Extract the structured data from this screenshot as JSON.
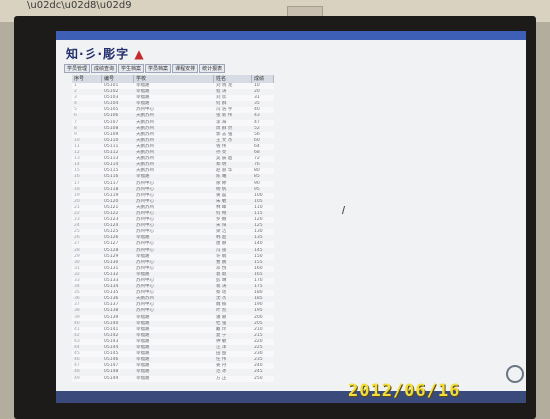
{
  "photo": {
    "timestamp": "2012/06/16"
  },
  "app": {
    "logo_left": "知·彡·彫字",
    "logo_mid": "  ",
    "tabs": [
      "学员管理",
      "成绩查询",
      "学生档案",
      "学员档案",
      "课程安排",
      "统计报表"
    ],
    "columns": [
      "序号",
      "编号",
      "学校",
      "姓名",
      "成绩"
    ],
    "rows": [
      [
        "1",
        "05101",
        "幸福路",
        "刘 晓 龙",
        "10"
      ],
      [
        "2",
        "05102",
        "幸福路",
        "程 涛",
        "20"
      ],
      [
        "3",
        "05103",
        "幸福路",
        "刘 欢",
        "31"
      ],
      [
        "4",
        "05104",
        "幸福路",
        "何 群",
        "35"
      ],
      [
        "5",
        "05105",
        "苏州中心",
        "冯 浩 宇",
        "40"
      ],
      [
        "6",
        "05106",
        "天鹏苏州",
        "张 新 伟",
        "43"
      ],
      [
        "7",
        "05107",
        "天鹏苏州",
        "李 海",
        "47"
      ],
      [
        "8",
        "05108",
        "天鹏苏州",
        "周 群 然",
        "52"
      ],
      [
        "9",
        "05109",
        "天鹏苏州",
        "郭 志 强",
        "56"
      ],
      [
        "10",
        "05110",
        "天鹏苏州",
        "王 文 杰",
        "60"
      ],
      [
        "11",
        "05111",
        "天鹏苏州",
        "钱 伟",
        "64"
      ],
      [
        "12",
        "05112",
        "天鹏苏州",
        "孙 亮",
        "68"
      ],
      [
        "13",
        "05113",
        "天鹏苏州",
        "吴 辰 超",
        "72"
      ],
      [
        "14",
        "05114",
        "天鹏苏州",
        "郑 明",
        "76"
      ],
      [
        "15",
        "05115",
        "天鹏苏州",
        "赵 丽 华",
        "80"
      ],
      [
        "16",
        "05116",
        "幸福路",
        "陈 曦",
        "85"
      ],
      [
        "17",
        "05117",
        "苏州中心",
        "徐 婷",
        "90"
      ],
      [
        "18",
        "05118",
        "苏州中心",
        "杨 帆",
        "95"
      ],
      [
        "19",
        "05119",
        "苏州中心",
        "黄 磊",
        "100"
      ],
      [
        "20",
        "05120",
        "苏州中心",
        "朱 敏",
        "105"
      ],
      [
        "21",
        "05121",
        "天鹏苏州",
        "林 峰",
        "110"
      ],
      [
        "22",
        "05122",
        "苏州中心",
        "何 畅",
        "115"
      ],
      [
        "23",
        "05123",
        "苏州中心",
        "罗 娜",
        "120"
      ],
      [
        "24",
        "05124",
        "苏州中心",
        "宋 阳",
        "125"
      ],
      [
        "25",
        "05125",
        "苏州中心",
        "梁 洁",
        "130"
      ],
      [
        "26",
        "05126",
        "幸福路",
        "韩 超",
        "135"
      ],
      [
        "27",
        "05127",
        "苏州中心",
        "唐 静",
        "140"
      ],
      [
        "28",
        "05128",
        "苏州中心",
        "冯 雷",
        "145"
      ],
      [
        "29",
        "05129",
        "幸福路",
        "许 娟",
        "150"
      ],
      [
        "30",
        "05130",
        "苏州中心",
        "曹 鹏",
        "155"
      ],
      [
        "31",
        "05131",
        "苏州中心",
        "邓 悦",
        "160"
      ],
      [
        "32",
        "05132",
        "幸福路",
        "袁 斌",
        "165"
      ],
      [
        "33",
        "05133",
        "苏州中心",
        "彭 琳",
        "170"
      ],
      [
        "34",
        "05134",
        "苏州中心",
        "蒋 涛",
        "175"
      ],
      [
        "35",
        "05135",
        "苏州中心",
        "蔡 瑶",
        "180"
      ],
      [
        "36",
        "05136",
        "天鹏苏州",
        "沈 杰",
        "185"
      ],
      [
        "37",
        "05137",
        "苏州中心",
        "魏 楠",
        "190"
      ],
      [
        "38",
        "05138",
        "苏州中心",
        "叶 凯",
        "195"
      ],
      [
        "39",
        "05139",
        "幸福路",
        "潘 颖",
        "200"
      ],
      [
        "40",
        "05140",
        "幸福路",
        "杜 强",
        "205"
      ],
      [
        "41",
        "05141",
        "幸福路",
        "戴 玲",
        "210"
      ],
      [
        "42",
        "05142",
        "幸福路",
        "夏 宁",
        "215"
      ],
      [
        "43",
        "05143",
        "幸福路",
        "钟 敏",
        "220"
      ],
      [
        "44",
        "05144",
        "幸福路",
        "汪 洋",
        "225"
      ],
      [
        "45",
        "05145",
        "幸福路",
        "田 甜",
        "230"
      ],
      [
        "46",
        "05146",
        "幸福路",
        "任 伟",
        "235"
      ],
      [
        "47",
        "05147",
        "幸福路",
        "姜 丹",
        "240"
      ],
      [
        "48",
        "05148",
        "幸福路",
        "范 冰",
        "245"
      ],
      [
        "49",
        "05149",
        "幸福路",
        "方 正",
        "250"
      ]
    ]
  }
}
